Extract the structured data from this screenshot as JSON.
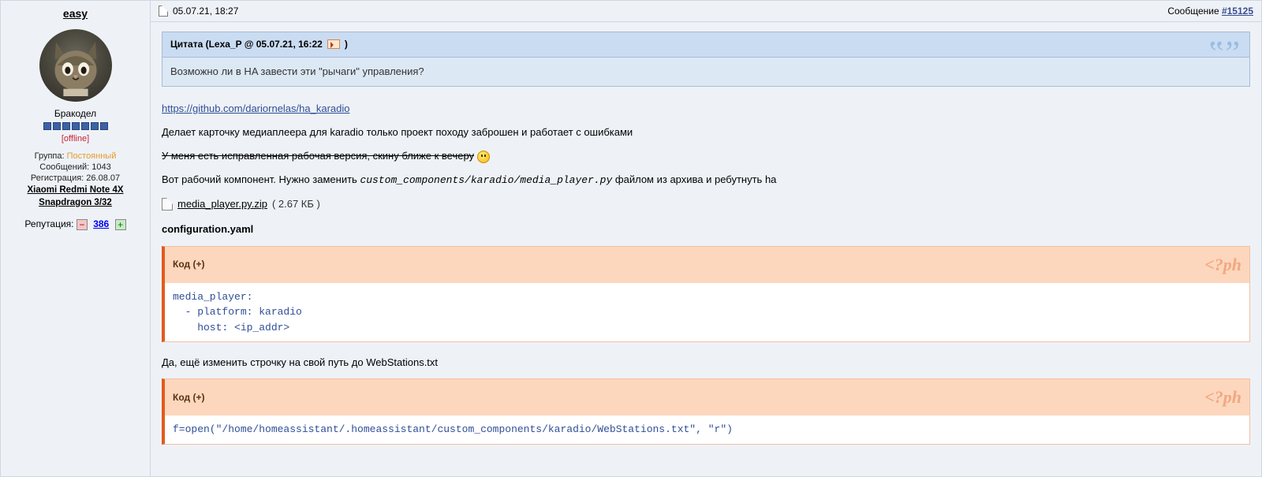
{
  "user": {
    "name": "easy",
    "rank": "Бракодел",
    "pips": 7,
    "status": "[offline]",
    "group_label": "Группа: ",
    "group_value": "Постоянный",
    "posts_label": "Сообщений: ",
    "posts_value": "1043",
    "reg_label": "Регистрация: ",
    "reg_value": "26.08.07",
    "device": "Xiaomi Redmi Note 4X Snapdragon 3/32",
    "rep_label": "Репутация: ",
    "rep_value": "386"
  },
  "post": {
    "datetime": "05.07.21, 18:27",
    "msg_label": "Сообщение ",
    "msg_number": "#15125"
  },
  "quote": {
    "head": "Цитата (Lexa_P @ 05.07.21, 16:22 ",
    "head_tail": ")",
    "body": "Возможно ли в HA завести эти \"рычаги\" управления?"
  },
  "body": {
    "github_link": "https://github.com/dariornelas/ha_karadio",
    "line1": "Делает карточку медиаплеера для karadio только проект походу заброшен и работает с ошибками",
    "strike": "У меня есть исправленная рабочая версия, скину ближе к вечеру",
    "line2a": "Вот рабочий компонент. Нужно заменить ",
    "line2_path": "custom_components/karadio/media_player.py",
    "line2b": " файлом из архива и ребутнуть ha",
    "attach_name": "media_player.py.zip",
    "attach_size": "( 2.67 КБ )",
    "conf_heading": "configuration.yaml",
    "code1_label": "Код (+)",
    "code1": "media_player:\n  - platform: karadio\n    host: <ip_addr>",
    "line3": "Да, ещё изменить строчку на свой путь до WebStations.txt",
    "code2_label": "Код (+)",
    "code2": "f=open(\"/home/homeassistant/.homeassistant/custom_components/karadio/WebStations.txt\", \"r\")",
    "php_deco": "<?ph"
  }
}
